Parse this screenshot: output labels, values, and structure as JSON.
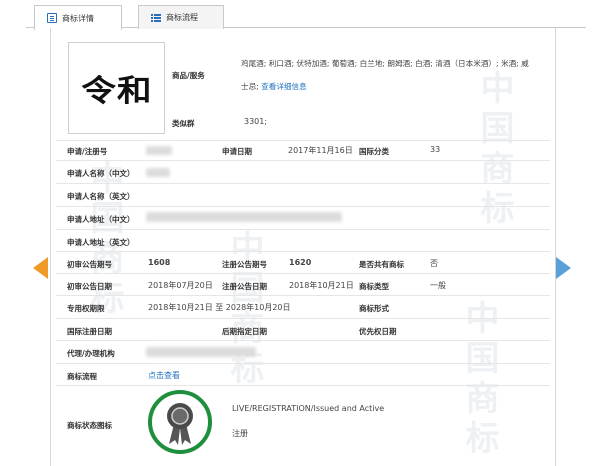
{
  "tabs": [
    {
      "label": "商标详情",
      "icon": "document-icon",
      "active": true
    },
    {
      "label": "商标流程",
      "icon": "list-icon",
      "active": false
    }
  ],
  "watermark": "中国商标",
  "logo_text": "令和",
  "goods": {
    "label": "商品/服务",
    "line1": "鸡尾酒; 利口酒; 伏特加酒; 葡萄酒; 白兰地; 朗姆酒; 白酒; 清酒（日本米酒）; 米酒; 威",
    "line2": "士忌;",
    "link": "查看详细信息"
  },
  "similar_group": {
    "label": "类似群",
    "value": "3301;"
  },
  "fields": {
    "app_no_label": "申请/注册号",
    "app_date_label": "申请日期",
    "app_date": "2017年11月16日",
    "intl_class_label": "国际分类",
    "intl_class": "33",
    "applicant_cn_label": "申请人名称（中文）",
    "applicant_en_label": "申请人名称（英文）",
    "address_cn_label": "申请人地址（中文）",
    "address_en_label": "申请人地址（英文）",
    "prelim_pub_no_label": "初审公告期号",
    "prelim_pub_no": "1608",
    "reg_pub_no_label": "注册公告期号",
    "reg_pub_no": "1620",
    "shared_label": "是否共有商标",
    "shared": "否",
    "prelim_pub_date_label": "初审公告日期",
    "prelim_pub_date": "2018年07月20日",
    "reg_pub_date_label": "注册公告日期",
    "reg_pub_date": "2018年10月21日",
    "mark_type_label": "商标类型",
    "mark_type": "一般",
    "exclusive_label": "专用权期限",
    "exclusive": "2018年10月21日 至 2028年10月20日",
    "form_label": "商标形式",
    "intl_reg_date_label": "国际注册日期",
    "later_date_label": "后期指定日期",
    "priority_date_label": "优先权日期",
    "agent_label": "代理/办理机构",
    "process_label": "商标流程",
    "process_link": "点击查看",
    "status_label": "商标状态图标",
    "status_text": "LIVE/REGISTRATION/Issued and Active",
    "status_sub": "注册"
  },
  "colors": {
    "link": "#1f73c1",
    "badge": "#1e8f3c",
    "prev_arrow": "#f09a2a",
    "next_arrow": "#5aa0d8"
  }
}
